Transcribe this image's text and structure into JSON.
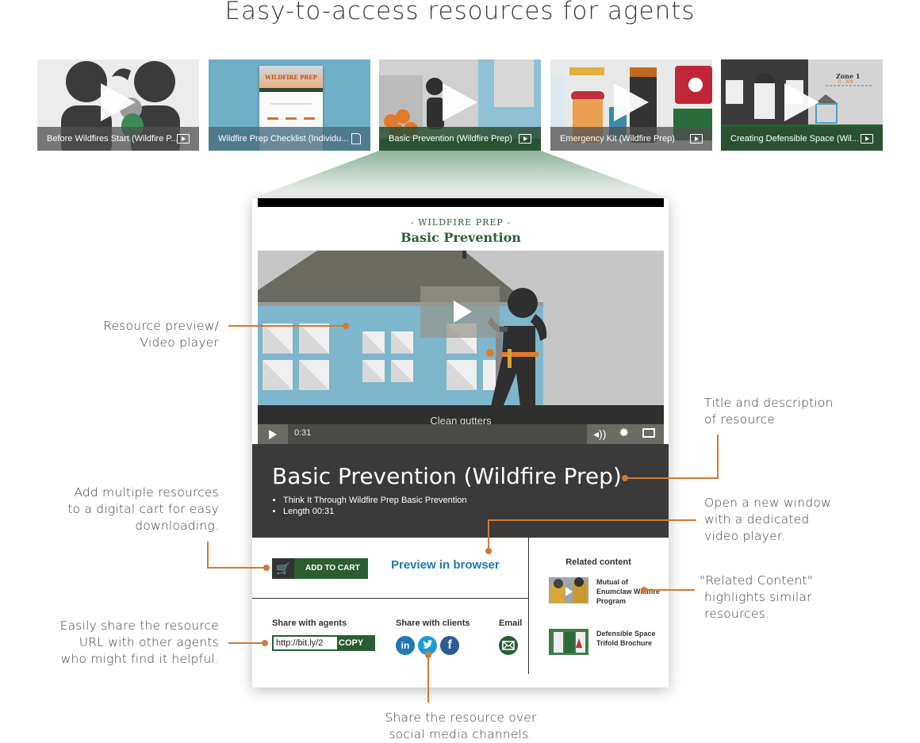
{
  "page_title": "Easy-to-access resources for agents",
  "thumbnails": [
    {
      "caption": "Before Wildfires Start (Wildfire P...",
      "type": "video",
      "icon": "video-play-icon"
    },
    {
      "caption": "Wildfire Prep Checklist (Individu...",
      "type": "document",
      "icon": "document-icon"
    },
    {
      "caption": "Basic Prevention (Wildfire Prep)",
      "type": "video",
      "icon": "video-play-icon",
      "selected": true
    },
    {
      "caption": "Emergency Kit (Wildfire Prep)",
      "type": "video",
      "icon": "video-play-icon"
    },
    {
      "caption": "Creating Defensible Space (Wil...",
      "type": "video",
      "icon": "video-play-icon"
    }
  ],
  "thumb_art": {
    "checklist_title": "WILDFIRE PREP",
    "zone_label": "Zone 1",
    "zone_range": "0 - 30ft"
  },
  "player": {
    "kicker": "- WILDFIRE PREP -",
    "video_title": "Basic Prevention",
    "subtitle": "Clean gutters",
    "time": "0:31",
    "icons": {
      "play": "play-icon",
      "volume": "volume-icon",
      "settings": "gear-icon",
      "fullscreen": "fullscreen-icon"
    }
  },
  "resource": {
    "title": "Basic Prevention (Wildfire Prep)",
    "details": [
      "Think It Through Wildfire Prep Basic Prevention",
      "Length 00:31"
    ]
  },
  "actions": {
    "add_to_cart": "ADD TO CART",
    "preview": "Preview in browser"
  },
  "share": {
    "agents_label": "Share with agents",
    "url_value": "http://bit.ly/2",
    "copy_label": "COPY",
    "clients_label": "Share with clients",
    "email_label": "Email",
    "social": [
      {
        "name": "LinkedIn",
        "glyph": "in",
        "color": "#1f78b4"
      },
      {
        "name": "Twitter",
        "glyph": "t",
        "color": "#1d9bd7"
      },
      {
        "name": "Facebook",
        "glyph": "f",
        "color": "#2d5a97"
      }
    ]
  },
  "related": {
    "heading": "Related content",
    "items": [
      {
        "title": "Mutual of Enumclaw Wildfire Program"
      },
      {
        "title": "Defensible Space Trifold Brochure"
      }
    ]
  },
  "annotations": {
    "preview": [
      "Resource preview/",
      "Video player"
    ],
    "cart": [
      "Add multiple resources",
      "to a digital cart for easy",
      "downloading."
    ],
    "share_url": [
      "Easily share the resource",
      "URL with other agents",
      "who might find it helpful."
    ],
    "title": [
      "Title and description",
      "of resource"
    ],
    "open_window": [
      "Open a new window",
      "with a dedicated",
      "video player."
    ],
    "related": [
      "\"Related Content\"",
      "highlights similar",
      "resources."
    ],
    "social": [
      "Share the resource over",
      "social media channels."
    ]
  },
  "colors": {
    "accent": "#d17a35",
    "brand_green": "#2a5d33",
    "link_blue": "#1e7ab0",
    "panel_dark": "#3a3a3a"
  }
}
